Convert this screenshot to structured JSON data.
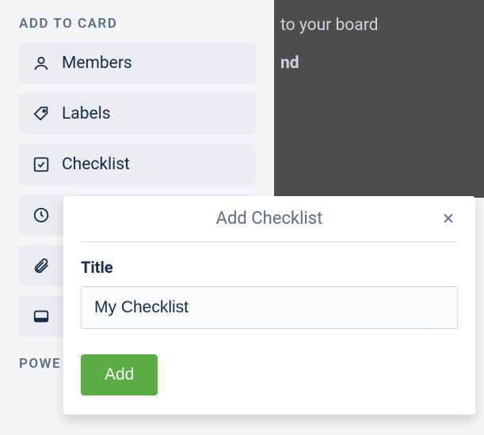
{
  "sidebar": {
    "section_title": "ADD TO CARD",
    "items": [
      {
        "label": "Members"
      },
      {
        "label": "Labels"
      },
      {
        "label": "Checklist"
      }
    ],
    "section2_title": "POWE"
  },
  "overlay": {
    "line1": " to your board",
    "line2": "nd"
  },
  "popover": {
    "title": "Add Checklist",
    "field_label": "Title",
    "input_value": "My Checklist",
    "add_label": "Add"
  }
}
